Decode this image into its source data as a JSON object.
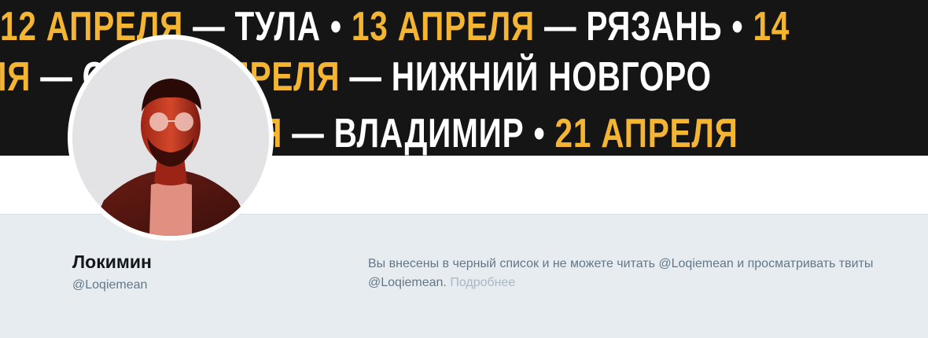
{
  "banner": {
    "row1": [
      {
        "text": "12 АПРЕЛЯ",
        "color": "yellow"
      },
      {
        "text": " — ТУЛА • ",
        "color": "white"
      },
      {
        "text": "13 АПРЕЛЯ",
        "color": "yellow"
      },
      {
        "text": " — РЯЗАНЬ • ",
        "color": "white"
      },
      {
        "text": "14",
        "color": "yellow"
      }
    ],
    "row2": [
      {
        "text": "ЛЯ",
        "color": "yellow"
      },
      {
        "text": " — ",
        "color": "white"
      },
      {
        "text": "",
        "color": "yellow"
      },
      {
        "text": "СК • ",
        "color": "white"
      },
      {
        "text": "17 АПРЕЛЯ",
        "color": "yellow"
      },
      {
        "text": " — НИЖНИЙ НОВГОРО",
        "color": "white"
      }
    ],
    "row3": [
      {
        "text": "ЛЯ",
        "color": "yellow"
      },
      {
        "text": " — ВЛАДИМИР • ",
        "color": "white"
      },
      {
        "text": "21 АПРЕЛЯ",
        "color": "yellow"
      }
    ],
    "colors": {
      "yellow": "#f4b533",
      "white": "#ffffff",
      "background": "#151515"
    }
  },
  "profile": {
    "name": "Локимин",
    "handle": "@Loqiemean"
  },
  "blocked_notice": {
    "message": "Вы внесены в черный список и не можете читать @Loqiemean и просматривать твиты @Loqiemean.",
    "learn_more": "Подробнее"
  }
}
